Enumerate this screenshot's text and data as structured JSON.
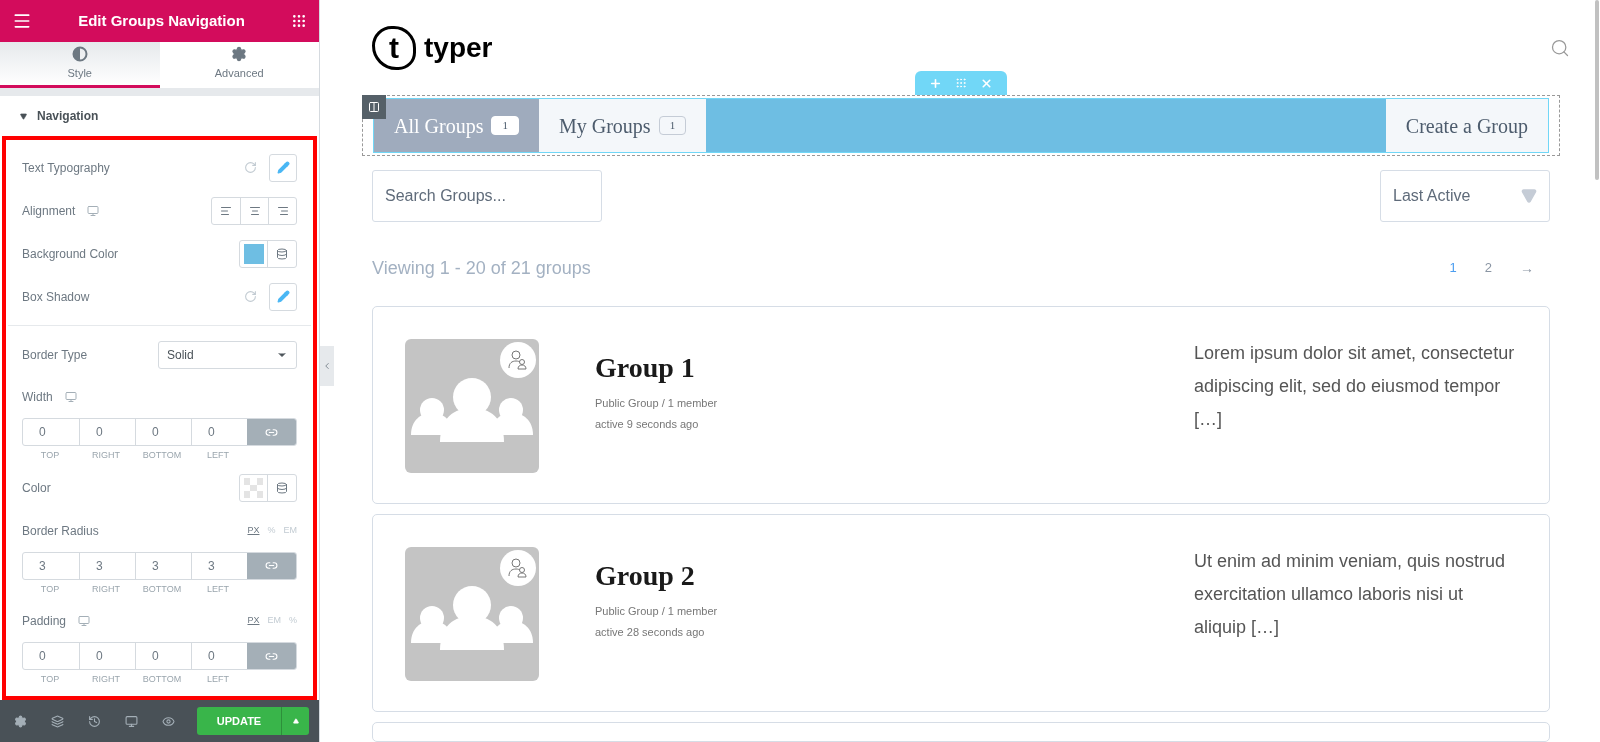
{
  "panel": {
    "title": "Edit Groups Navigation",
    "tabs": [
      {
        "label": "Style",
        "selected": true
      },
      {
        "label": "Advanced",
        "selected": false
      }
    ],
    "section": {
      "title": "Navigation",
      "expanded": true
    },
    "controls": [
      {
        "kind": "action",
        "label": "Text Typography"
      },
      {
        "kind": "alignment",
        "label": "Alignment",
        "responsive": true
      },
      {
        "kind": "color",
        "label": "Background Color",
        "color": "#6ebee3"
      },
      {
        "kind": "action",
        "label": "Box Shadow"
      },
      {
        "kind": "divider"
      },
      {
        "kind": "select",
        "label": "Border Type",
        "value": "Solid"
      },
      {
        "kind": "dimensions",
        "label": "Width",
        "responsive": true,
        "values": [
          "0",
          "0",
          "0",
          "0"
        ],
        "sides": [
          "TOP",
          "RIGHT",
          "BOTTOM",
          "LEFT"
        ]
      },
      {
        "kind": "color",
        "label": "Color"
      },
      {
        "kind": "dimensions",
        "label": "Border Radius",
        "units": [
          {
            "label": "PX",
            "selected": true
          },
          {
            "label": "%",
            "selected": false
          },
          {
            "label": "EM",
            "selected": false
          }
        ],
        "values": [
          "3",
          "3",
          "3",
          "3"
        ],
        "sides": [
          "TOP",
          "RIGHT",
          "BOTTOM",
          "LEFT"
        ]
      },
      {
        "kind": "dimensions",
        "label": "Padding",
        "responsive": true,
        "units": [
          {
            "label": "PX",
            "selected": true
          },
          {
            "label": "EM",
            "selected": false
          },
          {
            "label": "%",
            "selected": false
          }
        ],
        "values": [
          "0",
          "0",
          "0",
          "0"
        ],
        "sides": [
          "TOP",
          "RIGHT",
          "BOTTOM",
          "LEFT"
        ]
      }
    ],
    "footer": {
      "update": "UPDATE"
    }
  },
  "site": {
    "logo_mark": "t",
    "logo_text": "typer",
    "nav": {
      "items": [
        {
          "label": "All Groups",
          "count": "1",
          "selected": true
        },
        {
          "label": "My Groups",
          "count": "1",
          "selected": false
        }
      ],
      "create": "Create a Group"
    },
    "search": {
      "placeholder": "Search Groups..."
    },
    "sort": {
      "value": "Last Active"
    },
    "viewing": "Viewing 1 - 20 of 21 groups",
    "pages": [
      {
        "label": "1",
        "selected": true
      },
      {
        "label": "2",
        "selected": false
      }
    ],
    "next": "→",
    "groups": [
      {
        "name": "Group 1",
        "meta": "Public Group / 1 member",
        "active": "active 9 seconds ago",
        "description": "Lorem ipsum dolor sit amet, consectetur adipiscing elit, sed do eiusmod tempor […]"
      },
      {
        "name": "Group 2",
        "meta": "Public Group / 1 member",
        "active": "active 28 seconds ago",
        "description": "Ut enim ad minim veniam, quis nostrud exercitation ullamco laboris nisi ut aliquip […]"
      }
    ]
  }
}
